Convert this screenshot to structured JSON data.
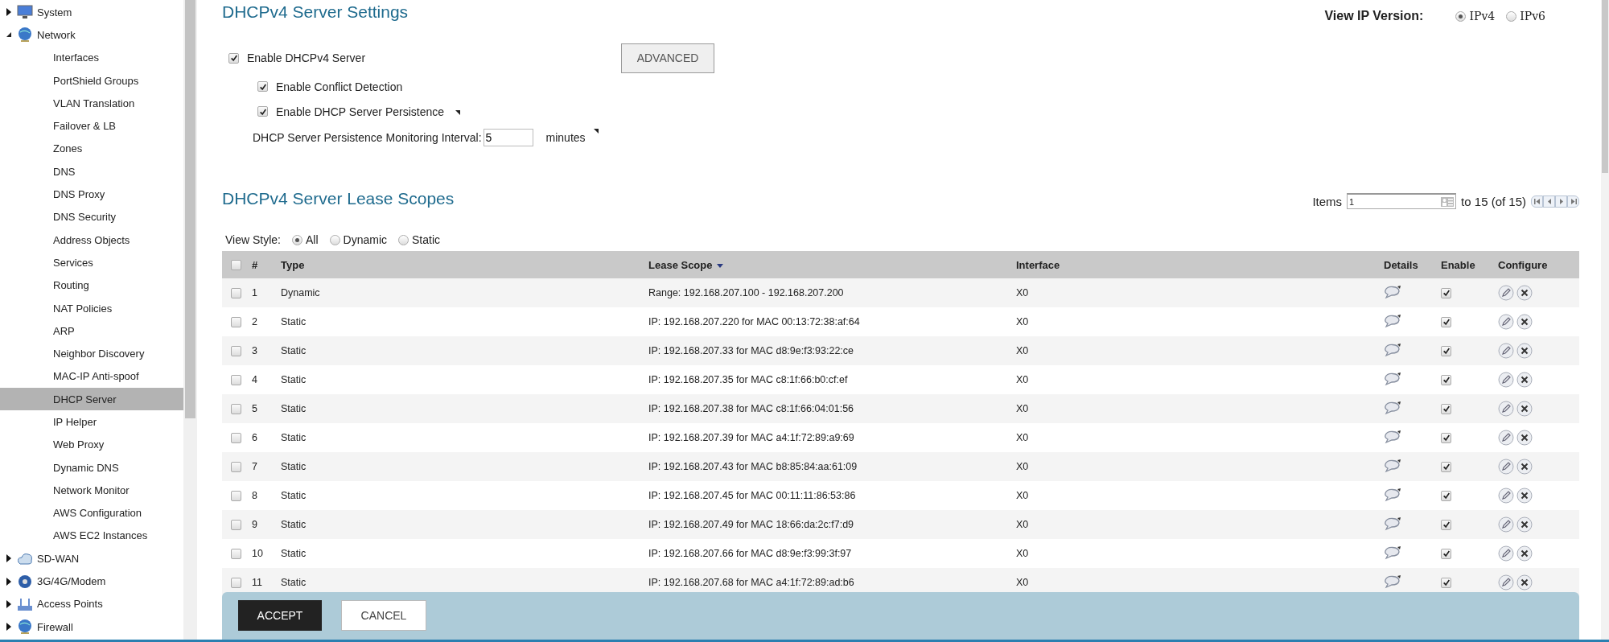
{
  "sidebar": {
    "items": [
      {
        "label": "System",
        "expanded": false
      },
      {
        "label": "Network",
        "expanded": true,
        "children": [
          {
            "label": "Interfaces",
            "selected": false
          },
          {
            "label": "PortShield Groups",
            "selected": false
          },
          {
            "label": "VLAN Translation",
            "selected": false
          },
          {
            "label": "Failover & LB",
            "selected": false
          },
          {
            "label": "Zones",
            "selected": false
          },
          {
            "label": "DNS",
            "selected": false
          },
          {
            "label": "DNS Proxy",
            "selected": false
          },
          {
            "label": "DNS Security",
            "selected": false
          },
          {
            "label": "Address Objects",
            "selected": false
          },
          {
            "label": "Services",
            "selected": false
          },
          {
            "label": "Routing",
            "selected": false
          },
          {
            "label": "NAT Policies",
            "selected": false
          },
          {
            "label": "ARP",
            "selected": false
          },
          {
            "label": "Neighbor Discovery",
            "selected": false
          },
          {
            "label": "MAC-IP Anti-spoof",
            "selected": false
          },
          {
            "label": "DHCP Server",
            "selected": true
          },
          {
            "label": "IP Helper",
            "selected": false
          },
          {
            "label": "Web Proxy",
            "selected": false
          },
          {
            "label": "Dynamic DNS",
            "selected": false
          },
          {
            "label": "Network Monitor",
            "selected": false
          },
          {
            "label": "AWS Configuration",
            "selected": false
          },
          {
            "label": "AWS EC2 Instances",
            "selected": false
          }
        ]
      },
      {
        "label": "SD-WAN",
        "expanded": false
      },
      {
        "label": "3G/4G/Modem",
        "expanded": false
      },
      {
        "label": "Access Points",
        "expanded": false
      },
      {
        "label": "Firewall",
        "expanded": false
      }
    ]
  },
  "settings": {
    "title": "DHCPv4 Server Settings",
    "enable_server": {
      "label": "Enable DHCPv4 Server",
      "checked": true,
      "children": [
        {
          "label": "Enable Conflict Detection",
          "checked": true,
          "tooltip": false
        },
        {
          "label": "Enable DHCP Server Persistence",
          "checked": true,
          "tooltip": true
        }
      ]
    },
    "advanced_button": "ADVANCED",
    "interval": {
      "label": "DHCP Server Persistence Monitoring Interval:",
      "value": "5",
      "unit": "minutes",
      "tooltip": true
    }
  },
  "ip_version": {
    "label": "View IP Version:",
    "options": [
      {
        "label": "IPv4",
        "selected": true
      },
      {
        "label": "IPv6",
        "selected": false
      }
    ]
  },
  "lease_scopes": {
    "title": "DHCPv4 Server Lease Scopes",
    "pager": {
      "label": "Items",
      "value": "1",
      "range": "to 15 (of 15)"
    },
    "view_style": {
      "label": "View Style:",
      "options": [
        {
          "label": "All",
          "selected": true
        },
        {
          "label": "Dynamic",
          "selected": false
        },
        {
          "label": "Static",
          "selected": false
        }
      ]
    },
    "table": {
      "select_all_checked": false,
      "columns": [
        {
          "label": "#",
          "sorted": false
        },
        {
          "label": "Type",
          "sorted": false
        },
        {
          "label": "Lease Scope",
          "sorted": true
        },
        {
          "label": "Interface",
          "sorted": false
        },
        {
          "label": "Details",
          "sorted": false
        },
        {
          "label": "Enable",
          "sorted": false
        },
        {
          "label": "Configure",
          "sorted": false
        }
      ],
      "rows": [
        {
          "number": "1",
          "type": "Dynamic",
          "lease_scope": "Range: 192.168.207.100 - 192.168.207.200",
          "interface": "X0",
          "checked": false,
          "enabled": true
        },
        {
          "number": "2",
          "type": "Static",
          "lease_scope": "IP: 192.168.207.220 for MAC 00:13:72:38:af:64",
          "interface": "X0",
          "checked": false,
          "enabled": true
        },
        {
          "number": "3",
          "type": "Static",
          "lease_scope": "IP: 192.168.207.33 for MAC d8:9e:f3:93:22:ce",
          "interface": "X0",
          "checked": false,
          "enabled": true
        },
        {
          "number": "4",
          "type": "Static",
          "lease_scope": "IP: 192.168.207.35 for MAC c8:1f:66:b0:cf:ef",
          "interface": "X0",
          "checked": false,
          "enabled": true
        },
        {
          "number": "5",
          "type": "Static",
          "lease_scope": "IP: 192.168.207.38 for MAC c8:1f:66:04:01:56",
          "interface": "X0",
          "checked": false,
          "enabled": true
        },
        {
          "number": "6",
          "type": "Static",
          "lease_scope": "IP: 192.168.207.39 for MAC a4:1f:72:89:a9:69",
          "interface": "X0",
          "checked": false,
          "enabled": true
        },
        {
          "number": "7",
          "type": "Static",
          "lease_scope": "IP: 192.168.207.43 for MAC b8:85:84:aa:61:09",
          "interface": "X0",
          "checked": false,
          "enabled": true
        },
        {
          "number": "8",
          "type": "Static",
          "lease_scope": "IP: 192.168.207.45 for MAC 00:11:11:86:53:86",
          "interface": "X0",
          "checked": false,
          "enabled": true
        },
        {
          "number": "9",
          "type": "Static",
          "lease_scope": "IP: 192.168.207.49 for MAC 18:66:da:2c:f7:d9",
          "interface": "X0",
          "checked": false,
          "enabled": true
        },
        {
          "number": "10",
          "type": "Static",
          "lease_scope": "IP: 192.168.207.66 for MAC d8:9e:f3:99:3f:97",
          "interface": "X0",
          "checked": false,
          "enabled": true
        },
        {
          "number": "11",
          "type": "Static",
          "lease_scope": "IP: 192.168.207.68 for MAC a4:1f:72:89:ad:b6",
          "interface": "X0",
          "checked": false,
          "enabled": true
        }
      ]
    }
  },
  "actions": {
    "accept": "ACCEPT",
    "cancel": "CANCEL"
  }
}
